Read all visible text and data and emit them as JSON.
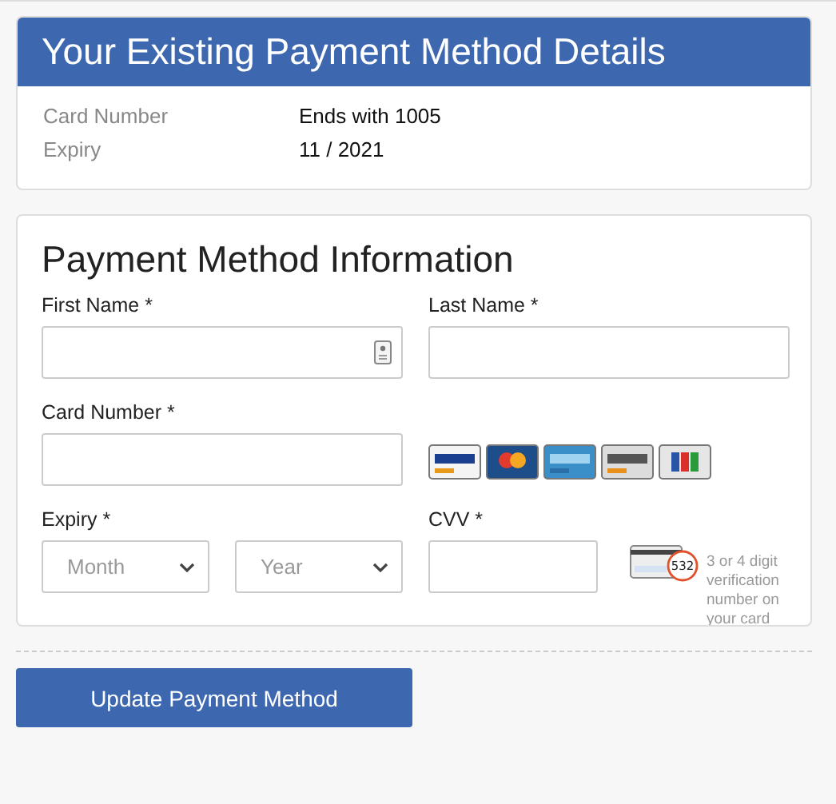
{
  "existing": {
    "title": "Your Existing Payment Method Details",
    "rows": [
      {
        "label": "Card Number",
        "value": "Ends with 1005"
      },
      {
        "label": "Expiry",
        "value": "11 / 2021"
      }
    ]
  },
  "form": {
    "title": "Payment Method Information",
    "first_name": {
      "label": "First Name *"
    },
    "last_name": {
      "label": "Last Name *"
    },
    "card_number": {
      "label": "Card Number *"
    },
    "expiry": {
      "label": "Expiry *",
      "month": "Month",
      "year": "Year"
    },
    "cvv": {
      "label": "CVV *",
      "hint": "3 or 4 digit verification number on your card",
      "card_code": "532"
    }
  },
  "button": "Update Payment Method"
}
